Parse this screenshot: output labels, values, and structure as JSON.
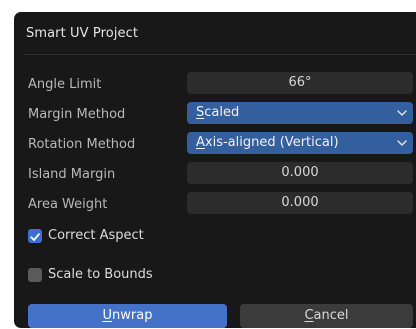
{
  "dialog": {
    "title": "Smart UV Project"
  },
  "fields": {
    "angle_limit": {
      "label": "Angle Limit",
      "value": "66°"
    },
    "margin_method": {
      "label": "Margin Method",
      "value_first": "S",
      "value_rest": "caled"
    },
    "rotation_method": {
      "label": "Rotation Method",
      "value_first": "A",
      "value_rest": "xis-aligned (Vertical)"
    },
    "island_margin": {
      "label": "Island Margin",
      "value": "0.000"
    },
    "area_weight": {
      "label": "Area Weight",
      "value": "0.000"
    }
  },
  "options": {
    "correct_aspect": {
      "label": "Correct Aspect",
      "checked": true
    },
    "scale_to_bounds": {
      "label": "Scale to Bounds",
      "checked": false
    }
  },
  "buttons": {
    "unwrap": {
      "first": "U",
      "rest": "nwrap"
    },
    "cancel": {
      "first": "C",
      "rest": "ancel"
    }
  },
  "colors": {
    "accent": "#4372c8",
    "dropdown": "#345f9e",
    "panel": "#181818"
  }
}
